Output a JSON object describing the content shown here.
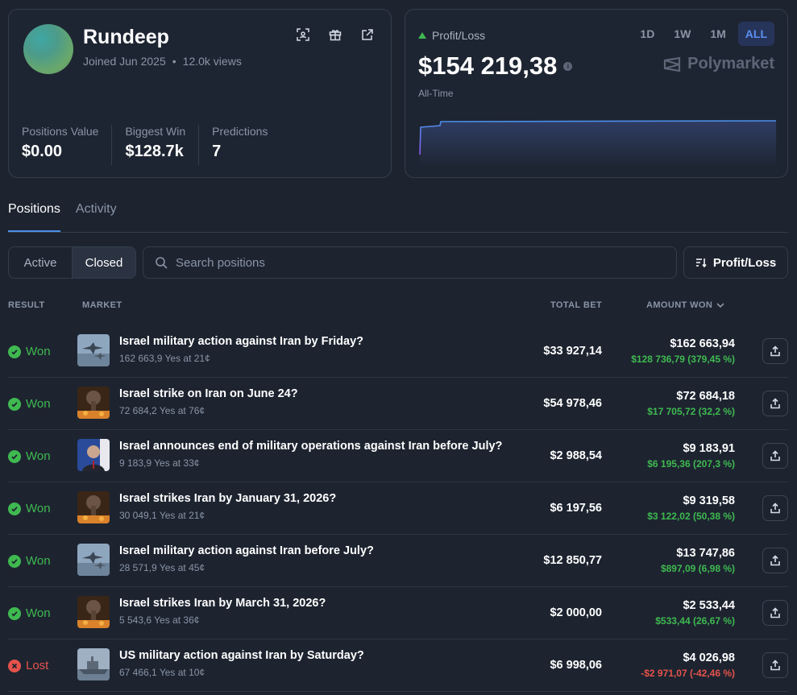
{
  "profile": {
    "username": "Rundeep",
    "joined": "Joined Jun 2025",
    "views": "12.0k views",
    "icons": [
      "scan-icon",
      "gift-icon",
      "external-link-icon"
    ],
    "stats": [
      {
        "label": "Positions Value",
        "value": "$0.00"
      },
      {
        "label": "Biggest Win",
        "value": "$128.7k"
      },
      {
        "label": "Predictions",
        "value": "7"
      }
    ]
  },
  "pnl": {
    "label": "Profit/Loss",
    "value": "$154 219,38",
    "period_label": "All-Time",
    "ranges": [
      "1D",
      "1W",
      "1M",
      "ALL"
    ],
    "active_range": "ALL",
    "brand": "Polymarket"
  },
  "tabs": [
    "Positions",
    "Activity"
  ],
  "filters": {
    "segments": [
      "Active",
      "Closed"
    ],
    "active_segment": "Closed",
    "search_placeholder": "Search positions",
    "sort_label": "Profit/Loss"
  },
  "columns": {
    "result": "RESULT",
    "market": "MARKET",
    "total_bet": "TOTAL BET",
    "amount_won": "AMOUNT WON"
  },
  "positions": [
    {
      "result": "Won",
      "thumb": "jets",
      "title": "Israel military action against Iran by Friday?",
      "sub": "162 663,9 Yes at 21¢",
      "total_bet": "$33 927,14",
      "amount_won": "$162 663,94",
      "pnl": "$128 736,79 (379,45 %)",
      "positive": true
    },
    {
      "result": "Won",
      "thumb": "explosion",
      "title": "Israel strike on Iran on June 24?",
      "sub": "72 684,2 Yes at 76¢",
      "total_bet": "$54 978,46",
      "amount_won": "$72 684,18",
      "pnl": "$17 705,72 (32,2 %)",
      "positive": true
    },
    {
      "result": "Won",
      "thumb": "portrait",
      "title": "Israel announces end of military operations against Iran before July?",
      "sub": "9 183,9 Yes at 33¢",
      "total_bet": "$2 988,54",
      "amount_won": "$9 183,91",
      "pnl": "$6 195,36 (207,3 %)",
      "positive": true
    },
    {
      "result": "Won",
      "thumb": "explosion",
      "title": "Israel strikes Iran by January 31, 2026?",
      "sub": "30 049,1 Yes at 21¢",
      "total_bet": "$6 197,56",
      "amount_won": "$9 319,58",
      "pnl": "$3 122,02 (50,38 %)",
      "positive": true
    },
    {
      "result": "Won",
      "thumb": "jets",
      "title": "Israel military action against Iran before July?",
      "sub": "28 571,9 Yes at 45¢",
      "total_bet": "$12 850,77",
      "amount_won": "$13 747,86",
      "pnl": "$897,09 (6,98 %)",
      "positive": true
    },
    {
      "result": "Won",
      "thumb": "explosion",
      "title": "Israel strikes Iran by March 31, 2026?",
      "sub": "5 543,6 Yes at 36¢",
      "total_bet": "$2 000,00",
      "amount_won": "$2 533,44",
      "pnl": "$533,44 (26,67 %)",
      "positive": true
    },
    {
      "result": "Lost",
      "thumb": "ship",
      "title": "US military action against Iran by Saturday?",
      "sub": "67 466,1 Yes at 10¢",
      "total_bet": "$6 998,06",
      "amount_won": "$4 026,98",
      "pnl": "-$2 971,07 (-42,46 %)",
      "positive": false
    }
  ],
  "colors": {
    "positive": "#3fb950",
    "negative": "#e5534b",
    "accent": "#4a8fe8"
  }
}
